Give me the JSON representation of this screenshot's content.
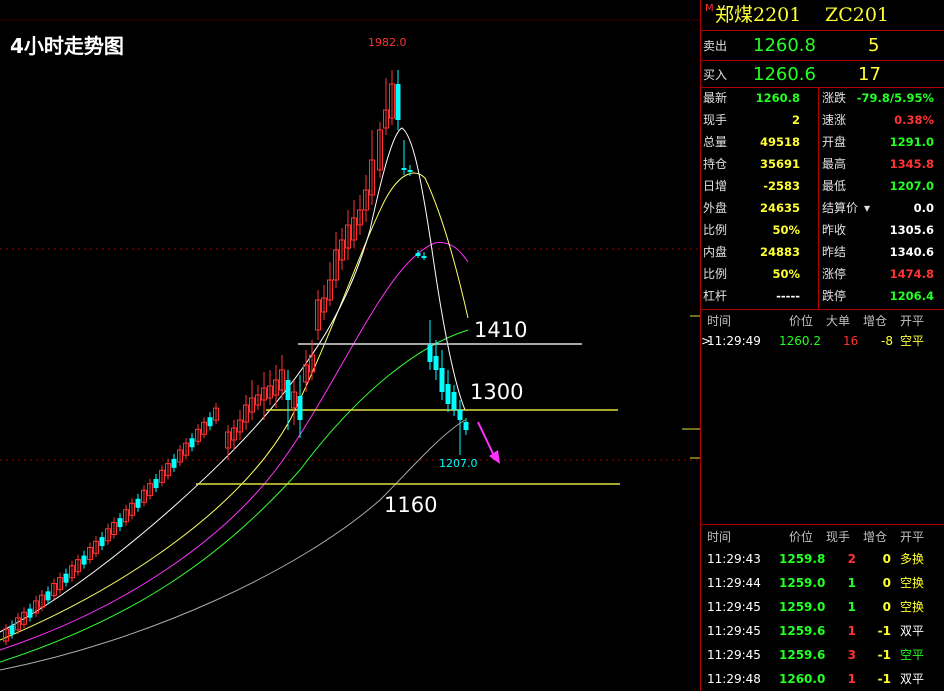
{
  "chart": {
    "title": "4小时走势图",
    "high_label": "1982.0",
    "low_label": "1207.0",
    "levels": [
      {
        "label": "1410",
        "value": 1410,
        "color": "#ffffff"
      },
      {
        "label": "1300",
        "value": 1300,
        "color": "#e0e040"
      },
      {
        "label": "1160",
        "value": 1160,
        "color": "#e0e040"
      }
    ],
    "colors": {
      "up": "#ff3333",
      "down": "#00ffff",
      "ma1": "#ffffff",
      "ma2": "#ffff66",
      "ma3": "#ff33ff",
      "ma4": "#33ff33",
      "ma5": "#aaaaaa",
      "arrow": "#ff33ff"
    }
  },
  "quote": {
    "marker": "M",
    "name": "郑煤2201",
    "code": "ZC201",
    "ask_label": "卖出",
    "ask_price": "1260.8",
    "ask_vol": "5",
    "bid_label": "买入",
    "bid_price": "1260.6",
    "bid_vol": "17",
    "stats_left": [
      {
        "label": "最新",
        "value": "1260.8",
        "color": "g"
      },
      {
        "label": "现手",
        "value": "2",
        "color": "y"
      },
      {
        "label": "总量",
        "value": "49518",
        "color": "y"
      },
      {
        "label": "持仓",
        "value": "35691",
        "color": "y"
      },
      {
        "label": "日增",
        "value": "-2583",
        "color": "y"
      },
      {
        "label": "外盘",
        "value": "24635",
        "color": "y"
      },
      {
        "label": "比例",
        "value": "50%",
        "color": "y"
      },
      {
        "label": "内盘",
        "value": "24883",
        "color": "y"
      },
      {
        "label": "比例",
        "value": "50%",
        "color": "y"
      },
      {
        "label": "杠杆",
        "value": "-----",
        "color": "w"
      }
    ],
    "stats_right": [
      {
        "label": "涨跌",
        "value": "-79.8/5.95%",
        "color": "g"
      },
      {
        "label": "速涨",
        "value": "0.38%",
        "color": "r"
      },
      {
        "label": "开盘",
        "value": "1291.0",
        "color": "g"
      },
      {
        "label": "最高",
        "value": "1345.8",
        "color": "r"
      },
      {
        "label": "最低",
        "value": "1207.0",
        "color": "g"
      },
      {
        "label": "结算价",
        "value": "0.0",
        "color": "w"
      },
      {
        "label": "昨收",
        "value": "1305.6",
        "color": "w"
      },
      {
        "label": "昨结",
        "value": "1340.6",
        "color": "w"
      },
      {
        "label": "涨停",
        "value": "1474.8",
        "color": "r"
      },
      {
        "label": "跌停",
        "value": "1206.4",
        "color": "g"
      }
    ],
    "settle_arrow": "▾"
  },
  "tick_header": {
    "time": "时间",
    "price": "价位",
    "big": "大单",
    "add": "增仓",
    "open": "开平"
  },
  "tick_row": {
    "marker": ">",
    "time": "11:29:49",
    "price": "1260.2",
    "big": "16",
    "add": "-8",
    "open": "空平"
  },
  "trade_header": {
    "time": "时间",
    "price": "价位",
    "vol": "现手",
    "add": "增仓",
    "open": "开平"
  },
  "trades": [
    {
      "time": "11:29:43",
      "price": "1259.8",
      "vol": "2",
      "add": "0",
      "open": "多换",
      "vc": "r",
      "oc": "y"
    },
    {
      "time": "11:29:44",
      "price": "1259.0",
      "vol": "1",
      "add": "0",
      "open": "空换",
      "vc": "g",
      "oc": "y"
    },
    {
      "time": "11:29:45",
      "price": "1259.0",
      "vol": "1",
      "add": "0",
      "open": "空换",
      "vc": "g",
      "oc": "y"
    },
    {
      "time": "11:29:45",
      "price": "1259.6",
      "vol": "1",
      "add": "-1",
      "open": "双平",
      "vc": "r",
      "oc": "w"
    },
    {
      "time": "11:29:45",
      "price": "1259.6",
      "vol": "3",
      "add": "-1",
      "open": "空平",
      "vc": "r",
      "oc": "g"
    },
    {
      "time": "11:29:48",
      "price": "1260.0",
      "vol": "1",
      "add": "-1",
      "open": "双平",
      "vc": "r",
      "oc": "w"
    }
  ]
}
